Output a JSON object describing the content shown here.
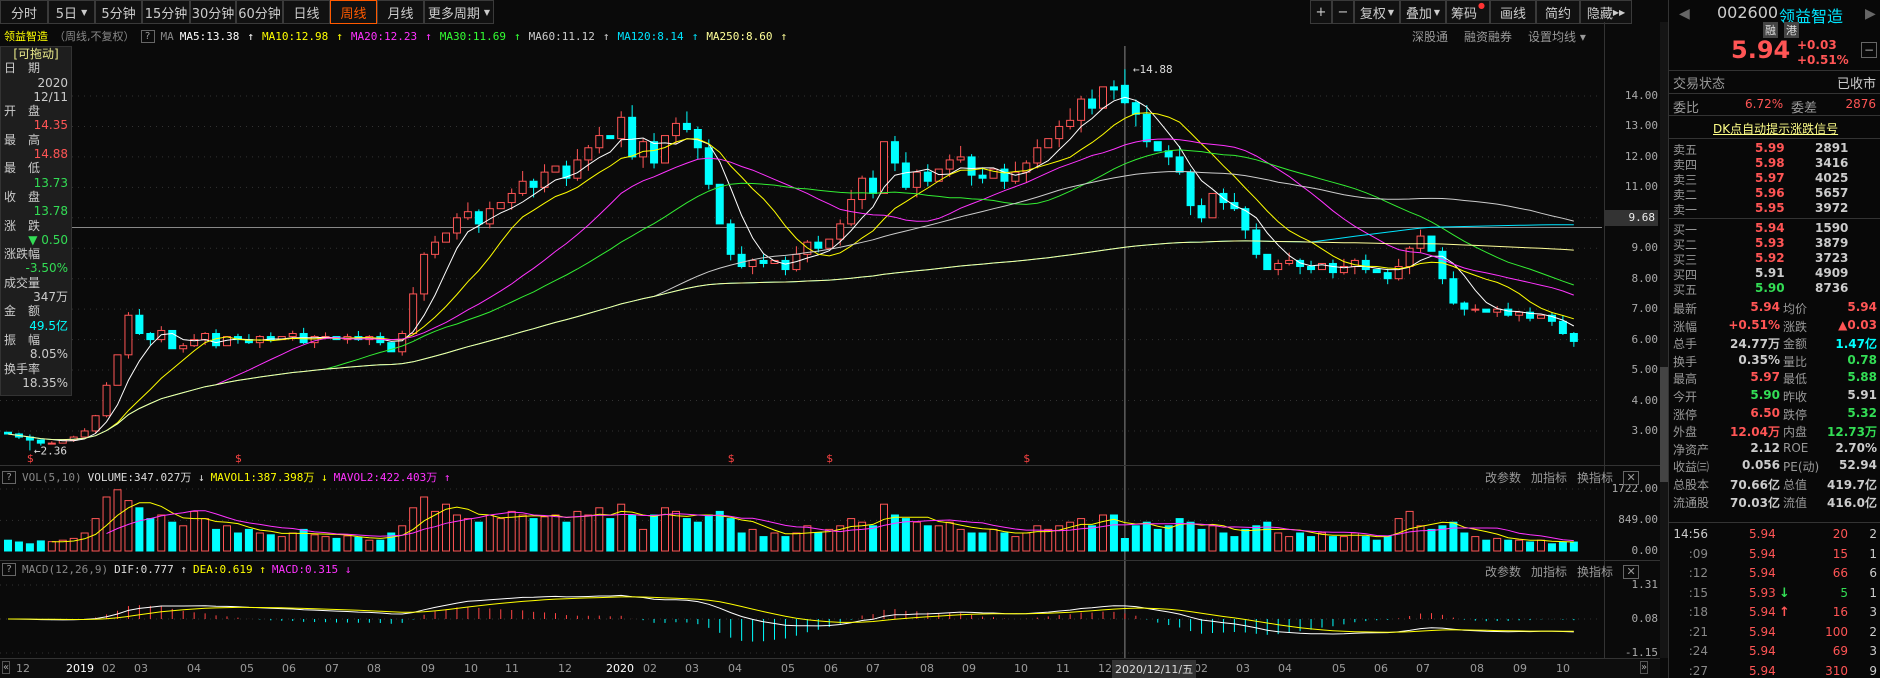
{
  "toolbar": {
    "periods": [
      "分时",
      "5日",
      "5分钟",
      "15分钟",
      "30分钟",
      "60分钟",
      "日线",
      "周线",
      "月线",
      "更多周期"
    ],
    "active": "周线",
    "right": [
      "+",
      "−",
      "复权",
      "叠加",
      "筹码",
      "画线",
      "简约",
      "隐藏"
    ]
  },
  "legend": {
    "name": "领益智造",
    "mode": "（周线,不复权）",
    "q": "?",
    "ma": "MA",
    "items": [
      {
        "t": "MA5:13.38",
        "c": "#ffffff",
        "dir": "↑"
      },
      {
        "t": "MA10:12.98",
        "c": "#ffff00",
        "dir": "↑"
      },
      {
        "t": "MA20:12.23",
        "c": "#ff33ff",
        "dir": "↑"
      },
      {
        "t": "MA30:11.69",
        "c": "#33ff33",
        "dir": "↑"
      },
      {
        "t": "MA60:11.12",
        "c": "#cccccc",
        "dir": "↑"
      },
      {
        "t": "MA120:8.14",
        "c": "#00e5ff",
        "dir": "↑"
      },
      {
        "t": "MA250:8.60",
        "c": "#ffff99",
        "dir": "↑"
      }
    ],
    "links": [
      "深股通",
      "融资融券",
      "设置均线"
    ]
  },
  "info": {
    "drag": "[可拖动]",
    "rows": [
      [
        "日　期",
        "2020",
        "12/11"
      ],
      [
        "开　盘",
        "14.35"
      ],
      [
        "最　高",
        "14.88"
      ],
      [
        "最　低",
        "13.73"
      ],
      [
        "收　盘",
        "13.78"
      ],
      [
        "涨　跌",
        "▼ 0.50"
      ],
      [
        "涨跌幅",
        "-3.50%"
      ],
      [
        "成交量",
        "347万"
      ],
      [
        "金　额",
        "49.5亿"
      ],
      [
        "振　幅",
        "8.05%"
      ],
      [
        "换手率",
        "18.35%"
      ]
    ]
  },
  "price_axis": [
    "14.00",
    "13.00",
    "12.00",
    "11.00",
    "9.00",
    "8.00",
    "7.00",
    "6.00",
    "5.00",
    "4.00",
    "3.00"
  ],
  "crosshair": {
    "price": "9.68",
    "date": "2020/12/11/五"
  },
  "annot_high": "14.88",
  "annot_low": "2.36",
  "vol": {
    "title": "VOL(5,10)",
    "volume": "VOLUME:347.027万 ↓",
    "mavol1": "MAVOL1:387.398万 ↓",
    "mavol2": "MAVOL2:422.403万 ↑",
    "axis": [
      "1722.00",
      "849.00",
      "0.00"
    ]
  },
  "macd": {
    "title": "MACD(12,26,9)",
    "dif": "DIF:0.777 ↑",
    "dea": "DEA:0.619 ↑",
    "macd": "MACD:0.315 ↓",
    "axis": [
      "1.31",
      "0.08",
      "-1.15"
    ]
  },
  "pane_btns": [
    "改参数",
    "加指标",
    "换指标"
  ],
  "xaxis": [
    "12",
    "2019",
    "02",
    "03",
    "04",
    "05",
    "06",
    "07",
    "08",
    "09",
    "10",
    "11",
    "12",
    "2020",
    "02",
    "03",
    "04",
    "05",
    "06",
    "07",
    "08",
    "09",
    "10",
    "11",
    "12",
    "02",
    "03",
    "04",
    "05",
    "06",
    "07",
    "08",
    "09",
    "10"
  ],
  "chart_data": {
    "type": "candlestick",
    "period": "weekly",
    "closes": [
      2.9,
      2.8,
      2.7,
      2.6,
      2.6,
      2.7,
      2.8,
      3.0,
      3.5,
      4.5,
      5.5,
      6.8,
      6.2,
      6.0,
      6.3,
      5.7,
      5.8,
      6.0,
      6.2,
      5.8,
      6.1,
      6.0,
      5.9,
      6.1,
      6.0,
      6.1,
      6.2,
      5.9,
      6.1,
      6.1,
      6.0,
      6.1,
      6.0,
      6.1,
      5.9,
      5.6,
      6.2,
      7.5,
      8.8,
      9.2,
      9.5,
      10.0,
      10.2,
      9.8,
      10.3,
      10.5,
      10.8,
      11.2,
      11.0,
      11.5,
      11.7,
      11.3,
      11.9,
      12.3,
      12.7,
      12.6,
      13.3,
      12.0,
      12.5,
      11.8,
      12.7,
      13.1,
      12.9,
      12.3,
      11.1,
      9.8,
      8.8,
      8.4,
      8.6,
      8.5,
      8.6,
      8.3,
      8.8,
      9.2,
      9.0,
      9.3,
      9.8,
      10.6,
      11.3,
      10.8,
      12.5,
      11.8,
      11.0,
      11.5,
      11.2,
      11.6,
      11.9,
      12.0,
      11.4,
      11.3,
      11.6,
      11.2,
      11.5,
      11.8,
      12.3,
      12.6,
      13.0,
      13.2,
      13.9,
      13.6,
      14.3,
      14.2,
      13.78,
      13.4,
      12.5,
      12.2,
      12.0,
      11.5,
      10.4,
      10.0,
      10.8,
      10.5,
      10.3,
      9.6,
      8.8,
      8.3,
      8.5,
      8.6,
      8.4,
      8.3,
      8.5,
      8.2,
      8.4,
      8.6,
      8.3,
      8.2,
      8.0,
      8.4,
      9.0,
      9.4,
      8.9,
      8.0,
      7.2,
      7.0,
      7.0,
      6.9,
      7.0,
      6.8,
      6.9,
      6.7,
      6.8,
      6.6,
      6.2,
      5.94
    ],
    "volumes": [
      300,
      250,
      200,
      280,
      260,
      300,
      350,
      500,
      900,
      1500,
      1700,
      1400,
      1200,
      900,
      1000,
      800,
      700,
      1100,
      900,
      600,
      700,
      500,
      600,
      500,
      450,
      400,
      500,
      600,
      450,
      400,
      350,
      420,
      380,
      300,
      300,
      500,
      700,
      1200,
      1500,
      1100,
      1300,
      1000,
      900,
      800,
      1000,
      900,
      1100,
      1000,
      900,
      950,
      1000,
      800,
      1100,
      1000,
      1200,
      900,
      1300,
      1000,
      600,
      1000,
      1200,
      1100,
      900,
      800,
      1000,
      1100,
      900,
      500,
      600,
      400,
      500,
      400,
      500,
      700,
      500,
      600,
      700,
      900,
      800,
      700,
      1300,
      1000,
      900,
      800,
      700,
      700,
      800,
      600,
      500,
      500,
      600,
      500,
      400,
      500,
      700,
      600,
      700,
      800,
      900,
      700,
      1000,
      1000,
      347,
      700,
      800,
      600,
      700,
      900,
      800,
      600,
      700,
      500,
      400,
      600,
      700,
      800,
      500,
      400,
      500,
      400,
      500,
      400,
      400,
      500,
      400,
      300,
      400,
      900,
      1100,
      700,
      600,
      700,
      800,
      500,
      400,
      300,
      350,
      300,
      300,
      250,
      300,
      200,
      250,
      248
    ],
    "highlight_index": 102,
    "signal_indices": [
      2,
      21,
      66,
      75,
      93
    ],
    "price_range": [
      2.36,
      14.88
    ],
    "vol_max": 1722
  },
  "rp": {
    "code": "002600",
    "name": "领益智造",
    "badges": [
      "融",
      "港"
    ],
    "price": "5.94",
    "chg": "+0.03",
    "pct": "+0.51%",
    "status_l": "交易状态",
    "status_v": "已收市",
    "wb_l": "委比",
    "wb_v": "6.72%",
    "wc_l": "委差",
    "wc_v": "2876",
    "dk": "DK点自动提示涨跌信号",
    "sell": [
      [
        "卖五",
        "5.99",
        "2891"
      ],
      [
        "卖四",
        "5.98",
        "3416"
      ],
      [
        "卖三",
        "5.97",
        "4025"
      ],
      [
        "卖二",
        "5.96",
        "5657"
      ],
      [
        "卖一",
        "5.95",
        "3972"
      ]
    ],
    "buy": [
      [
        "买一",
        "5.94",
        "1590"
      ],
      [
        "买二",
        "5.93",
        "3879"
      ],
      [
        "买三",
        "5.92",
        "3723"
      ],
      [
        "买四",
        "5.91",
        "4909"
      ],
      [
        "买五",
        "5.90",
        "8736"
      ]
    ],
    "stats": [
      [
        "最新",
        "5.94",
        "red",
        "均价",
        "5.94",
        "red"
      ],
      [
        "涨幅",
        "+0.51%",
        "red",
        "涨跌",
        "▲0.03",
        "red"
      ],
      [
        "总手",
        "24.77万",
        "wh",
        "金额",
        "1.47亿",
        "cy"
      ],
      [
        "换手",
        "0.35%",
        "wh",
        "量比",
        "0.78",
        "grn"
      ],
      [
        "最高",
        "5.97",
        "red",
        "最低",
        "5.88",
        "grn"
      ],
      [
        "今开",
        "5.90",
        "grn",
        "昨收",
        "5.91",
        "wh"
      ],
      [
        "涨停",
        "6.50",
        "red",
        "跌停",
        "5.32",
        "grn"
      ],
      [
        "外盘",
        "12.04万",
        "red",
        "内盘",
        "12.73万",
        "grn"
      ],
      [
        "净资产",
        "2.12",
        "wh",
        "ROE",
        "2.70%",
        "wh"
      ],
      [
        "收益㈢",
        "0.056",
        "wh",
        "PE(动)",
        "52.94",
        "wh"
      ],
      [
        "总股本",
        "70.66亿",
        "wh",
        "总值",
        "419.7亿",
        "wh"
      ],
      [
        "流通股",
        "70.03亿",
        "wh",
        "流值",
        "416.0亿",
        "wh"
      ]
    ],
    "ticks": [
      [
        "14:56",
        "5.94",
        "",
        "20",
        "2"
      ],
      [
        ":09",
        "5.94",
        "",
        "15",
        "1"
      ],
      [
        ":12",
        "5.94",
        "",
        "66",
        "6"
      ],
      [
        ":15",
        "5.93",
        "↓",
        "5",
        "1"
      ],
      [
        ":18",
        "5.94",
        "↑",
        "16",
        "3"
      ],
      [
        ":21",
        "5.94",
        "",
        "100",
        "2"
      ],
      [
        ":24",
        "5.94",
        "",
        "69",
        "3"
      ],
      [
        ":27",
        "5.94",
        "",
        "310",
        "9"
      ]
    ]
  },
  "colors": {
    "up": "#ff5555",
    "down": "#00ffff",
    "bg": "#0a0a0a"
  }
}
